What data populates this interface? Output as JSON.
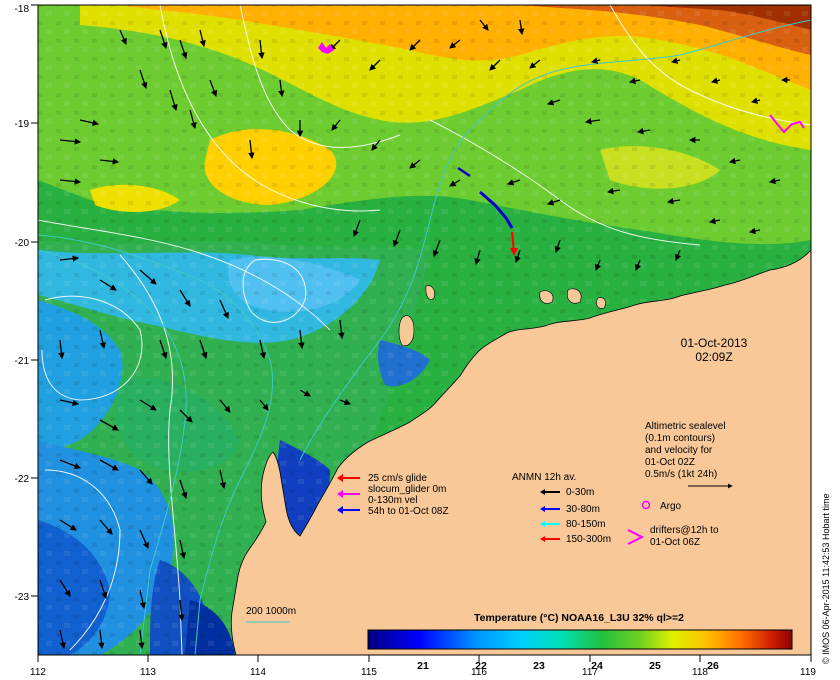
{
  "map": {
    "lon_ticks": [
      "112",
      "113",
      "114",
      "115",
      "116",
      "117",
      "118",
      "119"
    ],
    "lat_ticks": [
      "-18",
      "-19",
      "-20",
      "-21",
      "-22",
      "-23"
    ],
    "datetime": {
      "date": "01-Oct-2013",
      "time": "02:09Z"
    },
    "credit": "© IMOS 06-Apr-2015 11:42:53 Hobart time",
    "altimetry": {
      "lines": [
        "Altimetric sealevel",
        "(0.1m contours)",
        "and velocity for",
        "01-Oct 02Z",
        "0.5m/s (1kt 24h)"
      ]
    },
    "argo": {
      "label": "Argo"
    },
    "drifters": {
      "lines": [
        "drifters@12h to",
        "01-Oct 06Z"
      ]
    },
    "glider": {
      "lines": [
        "25 cm/s glide",
        "slocum_glider 0m",
        "0-130m vel",
        "54h to 01-Oct 08Z"
      ],
      "colors": [
        "#ff0000",
        "#ff00ff",
        "#ff00ff",
        "#0000ff"
      ]
    },
    "anmn": {
      "title": "ANMN 12h av.",
      "items": [
        {
          "label": "0-30m",
          "color": "#000000"
        },
        {
          "label": "30-80m",
          "color": "#0000ff"
        },
        {
          "label": "80-150m",
          "color": "#00ffff"
        },
        {
          "label": "150-300m",
          "color": "#ff0000"
        }
      ]
    },
    "isobath": {
      "label": "200 1000m",
      "color": "#40c0c0"
    },
    "colorbar": {
      "title": "Temperature (°C) NOAA16_L3U 32% ql>=2",
      "ticks": [
        "21",
        "22",
        "23",
        "24",
        "25",
        "26"
      ],
      "colors": [
        "#00007f",
        "#0000ff",
        "#0080ff",
        "#00c8ff",
        "#00e0c0",
        "#20c040",
        "#60c020",
        "#c0e000",
        "#ffe000",
        "#ff9000",
        "#e04000",
        "#8b0000"
      ]
    },
    "land_color": "#f8c898"
  }
}
